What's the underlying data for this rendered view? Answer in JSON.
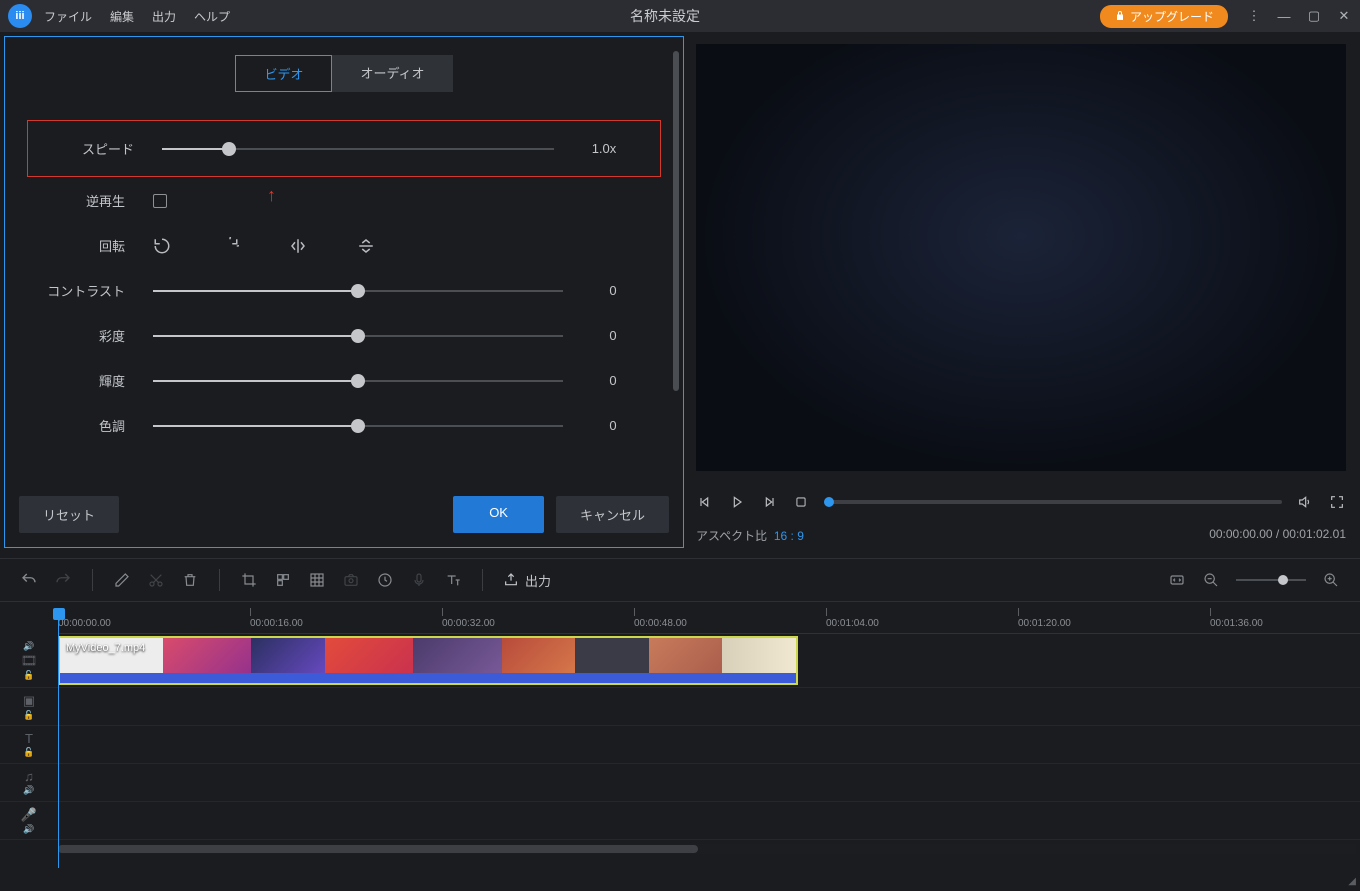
{
  "titlebar": {
    "title": "名称未設定",
    "menus": [
      "ファイル",
      "編集",
      "出力",
      "ヘルプ"
    ],
    "upgrade": "アップグレード"
  },
  "tabs": {
    "video": "ビデオ",
    "audio": "オーディオ"
  },
  "params": {
    "speed": {
      "label": "スピード",
      "value": "1.0x",
      "pos": 17
    },
    "reverse": {
      "label": "逆再生"
    },
    "rotate": {
      "label": "回転"
    },
    "contrast": {
      "label": "コントラスト",
      "value": "0",
      "pos": 50
    },
    "saturation": {
      "label": "彩度",
      "value": "0",
      "pos": 50
    },
    "brightness": {
      "label": "輝度",
      "value": "0",
      "pos": 50
    },
    "hue": {
      "label": "色調",
      "value": "0",
      "pos": 50
    }
  },
  "buttons": {
    "reset": "リセット",
    "ok": "OK",
    "cancel": "キャンセル"
  },
  "preview": {
    "aspect_label": "アスペクト比",
    "aspect_value": "16 : 9",
    "time": "00:00:00.00 / 00:01:02.01"
  },
  "toolbar": {
    "export": "出力"
  },
  "timeline": {
    "ticks": [
      "00:00:00.00",
      "00:00:16.00",
      "00:00:32.00",
      "00:00:48.00",
      "00:01:04.00",
      "00:01:20.00",
      "00:01:36.00"
    ],
    "clip_name": "MyVideo_7.mp4"
  }
}
